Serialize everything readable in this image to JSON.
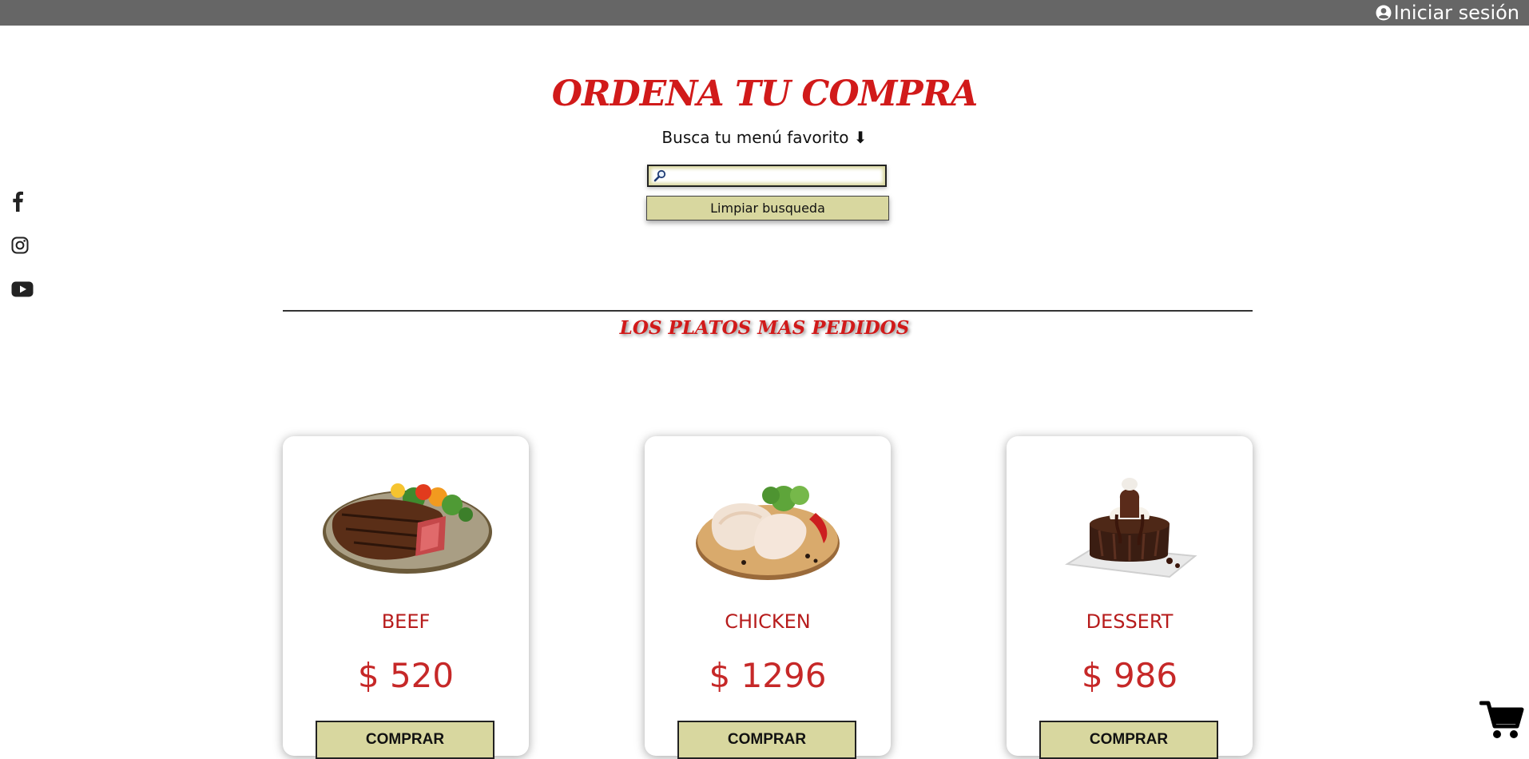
{
  "header": {
    "login_label": "Iniciar sesión",
    "login_icon": "user-circle-icon"
  },
  "social": [
    {
      "name": "facebook",
      "icon": "facebook-icon"
    },
    {
      "name": "instagram",
      "icon": "instagram-icon"
    },
    {
      "name": "youtube",
      "icon": "youtube-icon"
    }
  ],
  "main": {
    "title": "ORDENA TU COMPRA",
    "subtitle": "Busca tu menú favorito ⬇",
    "search": {
      "placeholder": "",
      "value": "",
      "icon": "search-icon"
    },
    "clear_label": "Limpiar busqueda",
    "section_title": "LOS PLATOS MAS PEDIDOS"
  },
  "products": [
    {
      "name": "BEEF",
      "price": "$ 520",
      "button": "COMPRAR",
      "image": "steak-plate"
    },
    {
      "name": "CHICKEN",
      "price": "$ 1296",
      "button": "COMPRAR",
      "image": "chicken-board"
    },
    {
      "name": "DESSERT",
      "price": "$ 986",
      "button": "COMPRAR",
      "image": "chocolate-cake"
    }
  ],
  "cart": {
    "icon": "cart-icon"
  },
  "colors": {
    "topbar": "#666666",
    "accent": "#d11a1a",
    "button": "#d8d79f"
  }
}
